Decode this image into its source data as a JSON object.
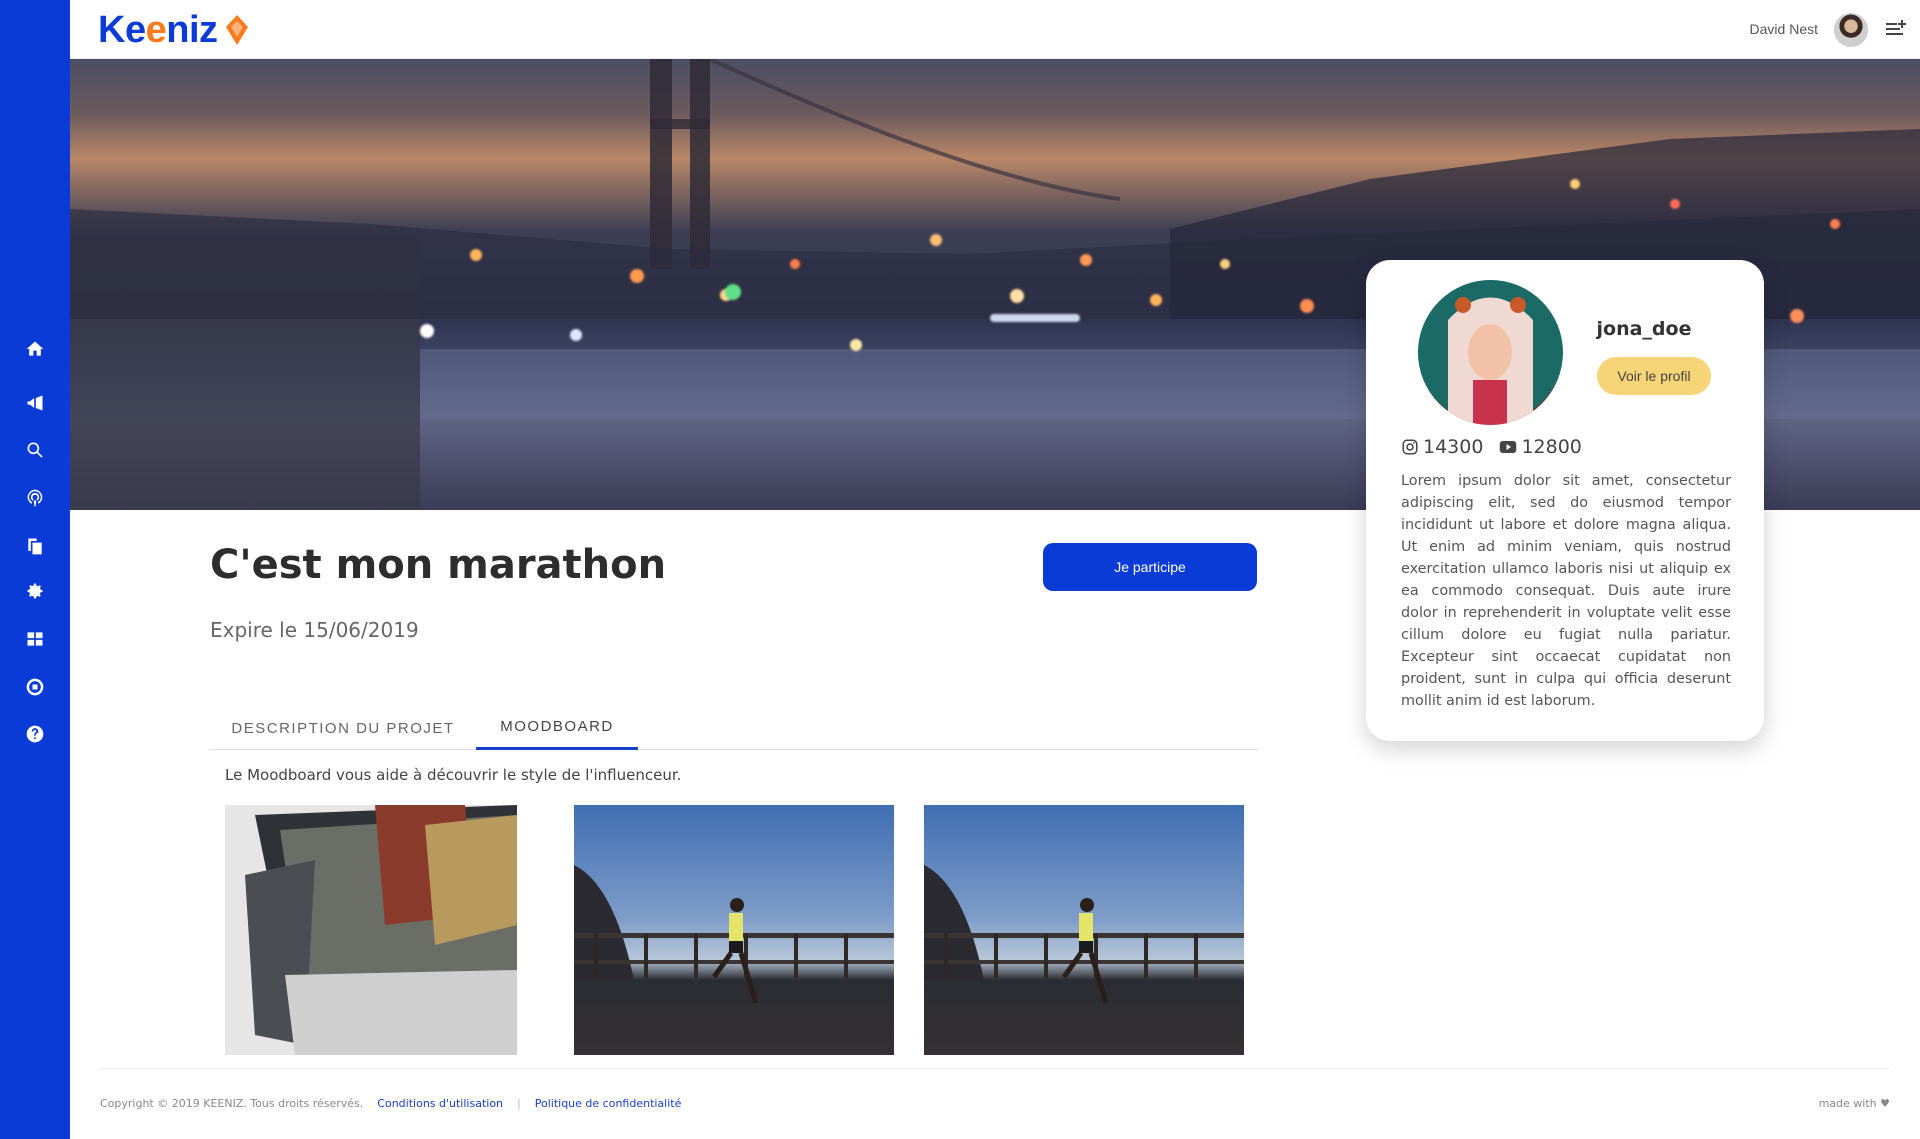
{
  "brand": {
    "name": "Keeniz",
    "colors": {
      "primary": "#0a3bd6",
      "accent": "#ff7a1a",
      "button_yellow": "#f7d477"
    }
  },
  "header": {
    "user_name": "David Nest"
  },
  "sidebar": {
    "items": [
      "home-icon",
      "megaphone-icon",
      "search-icon",
      "podcast-icon",
      "documents-icon",
      "gear-icon",
      "grid-icon",
      "record-icon",
      "help-icon"
    ]
  },
  "campaign": {
    "title": "C'est mon marathon",
    "expiry": "Expire le 15/06/2019",
    "participate_label": "Je participe"
  },
  "tabs": [
    {
      "label": "DESCRIPTION DU PROJET",
      "active": false
    },
    {
      "label": "MOODBOARD",
      "active": true
    }
  ],
  "moodboard": {
    "description": "Le Moodboard vous aide à découvrir le style de l'influenceur."
  },
  "profile": {
    "username": "jona_doe",
    "view_profile_label": "Voir le profil",
    "instagram_followers": "14300",
    "youtube_subscribers": "12800",
    "bio": "Lorem ipsum dolor sit amet, consectetur adipiscing elit, sed do eiusmod tempor incididunt ut labore et dolore magna aliqua. Ut enim ad minim veniam, quis nostrud exercitation ullamco laboris nisi ut aliquip ex ea commodo consequat. Duis aute irure dolor in reprehenderit in voluptate velit esse cillum dolore eu fugiat nulla pariatur. Excepteur sint occaecat cupidatat non proident, sunt in culpa qui officia deserunt mollit anim id est laborum."
  },
  "footer": {
    "copyright": "Copyright © 2019 KEENIZ. Tous droits réservés.",
    "terms": "Conditions d'utilisation",
    "privacy": "Politique de confidentialité",
    "made_with": "made with ♥"
  }
}
